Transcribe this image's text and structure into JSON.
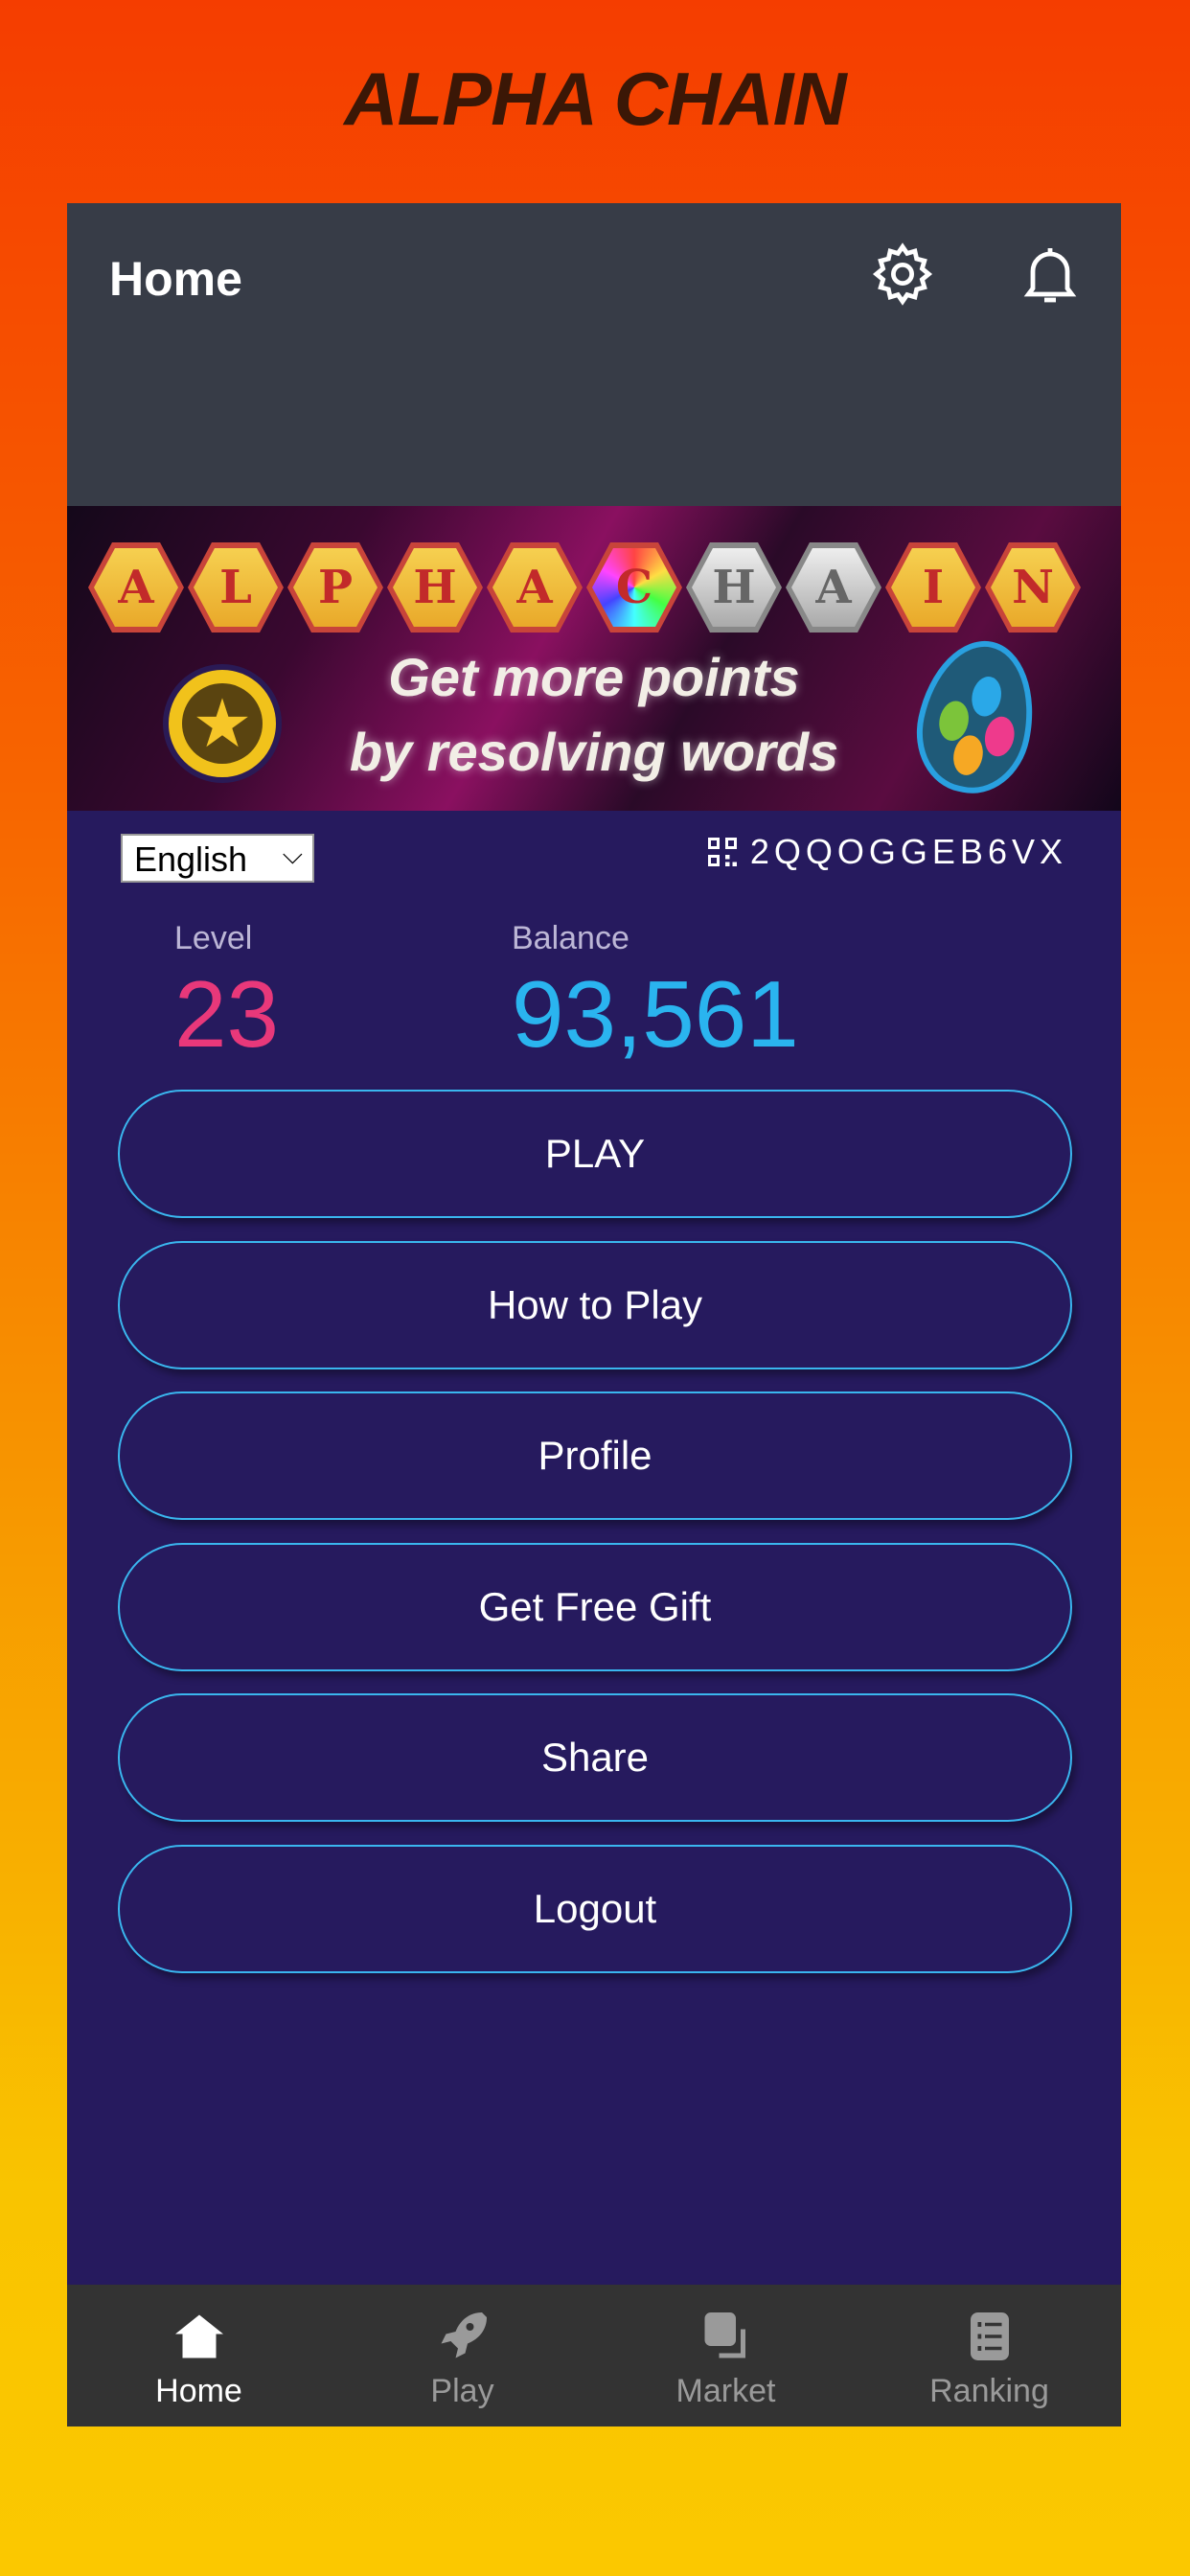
{
  "app_title": "ALPHA CHAIN",
  "header": {
    "title": "Home",
    "icons": [
      "gear-icon",
      "bell-icon"
    ]
  },
  "banner": {
    "letters": [
      "A",
      "L",
      "P",
      "H",
      "A",
      "C",
      "H",
      "A",
      "I",
      "N"
    ],
    "slogan_line1": "Get more points",
    "slogan_line2": "by resolving words"
  },
  "language": {
    "selected": "English"
  },
  "user_code": "2QQOGGEB6VX",
  "stats": {
    "level_label": "Level",
    "level_value": "23",
    "balance_label": "Balance",
    "balance_value": "93,561",
    "level_color": "#e8387a",
    "balance_color": "#2ab4ef"
  },
  "buttons": [
    "PLAY",
    "How to Play",
    "Profile",
    "Get Free Gift",
    "Share",
    "Logout"
  ],
  "nav": [
    {
      "label": "Home",
      "icon": "home-icon",
      "active": true
    },
    {
      "label": "Play",
      "icon": "rocket-icon"
    },
    {
      "label": "Market",
      "icon": "market-icon"
    },
    {
      "label": "Ranking",
      "icon": "list-icon"
    }
  ]
}
